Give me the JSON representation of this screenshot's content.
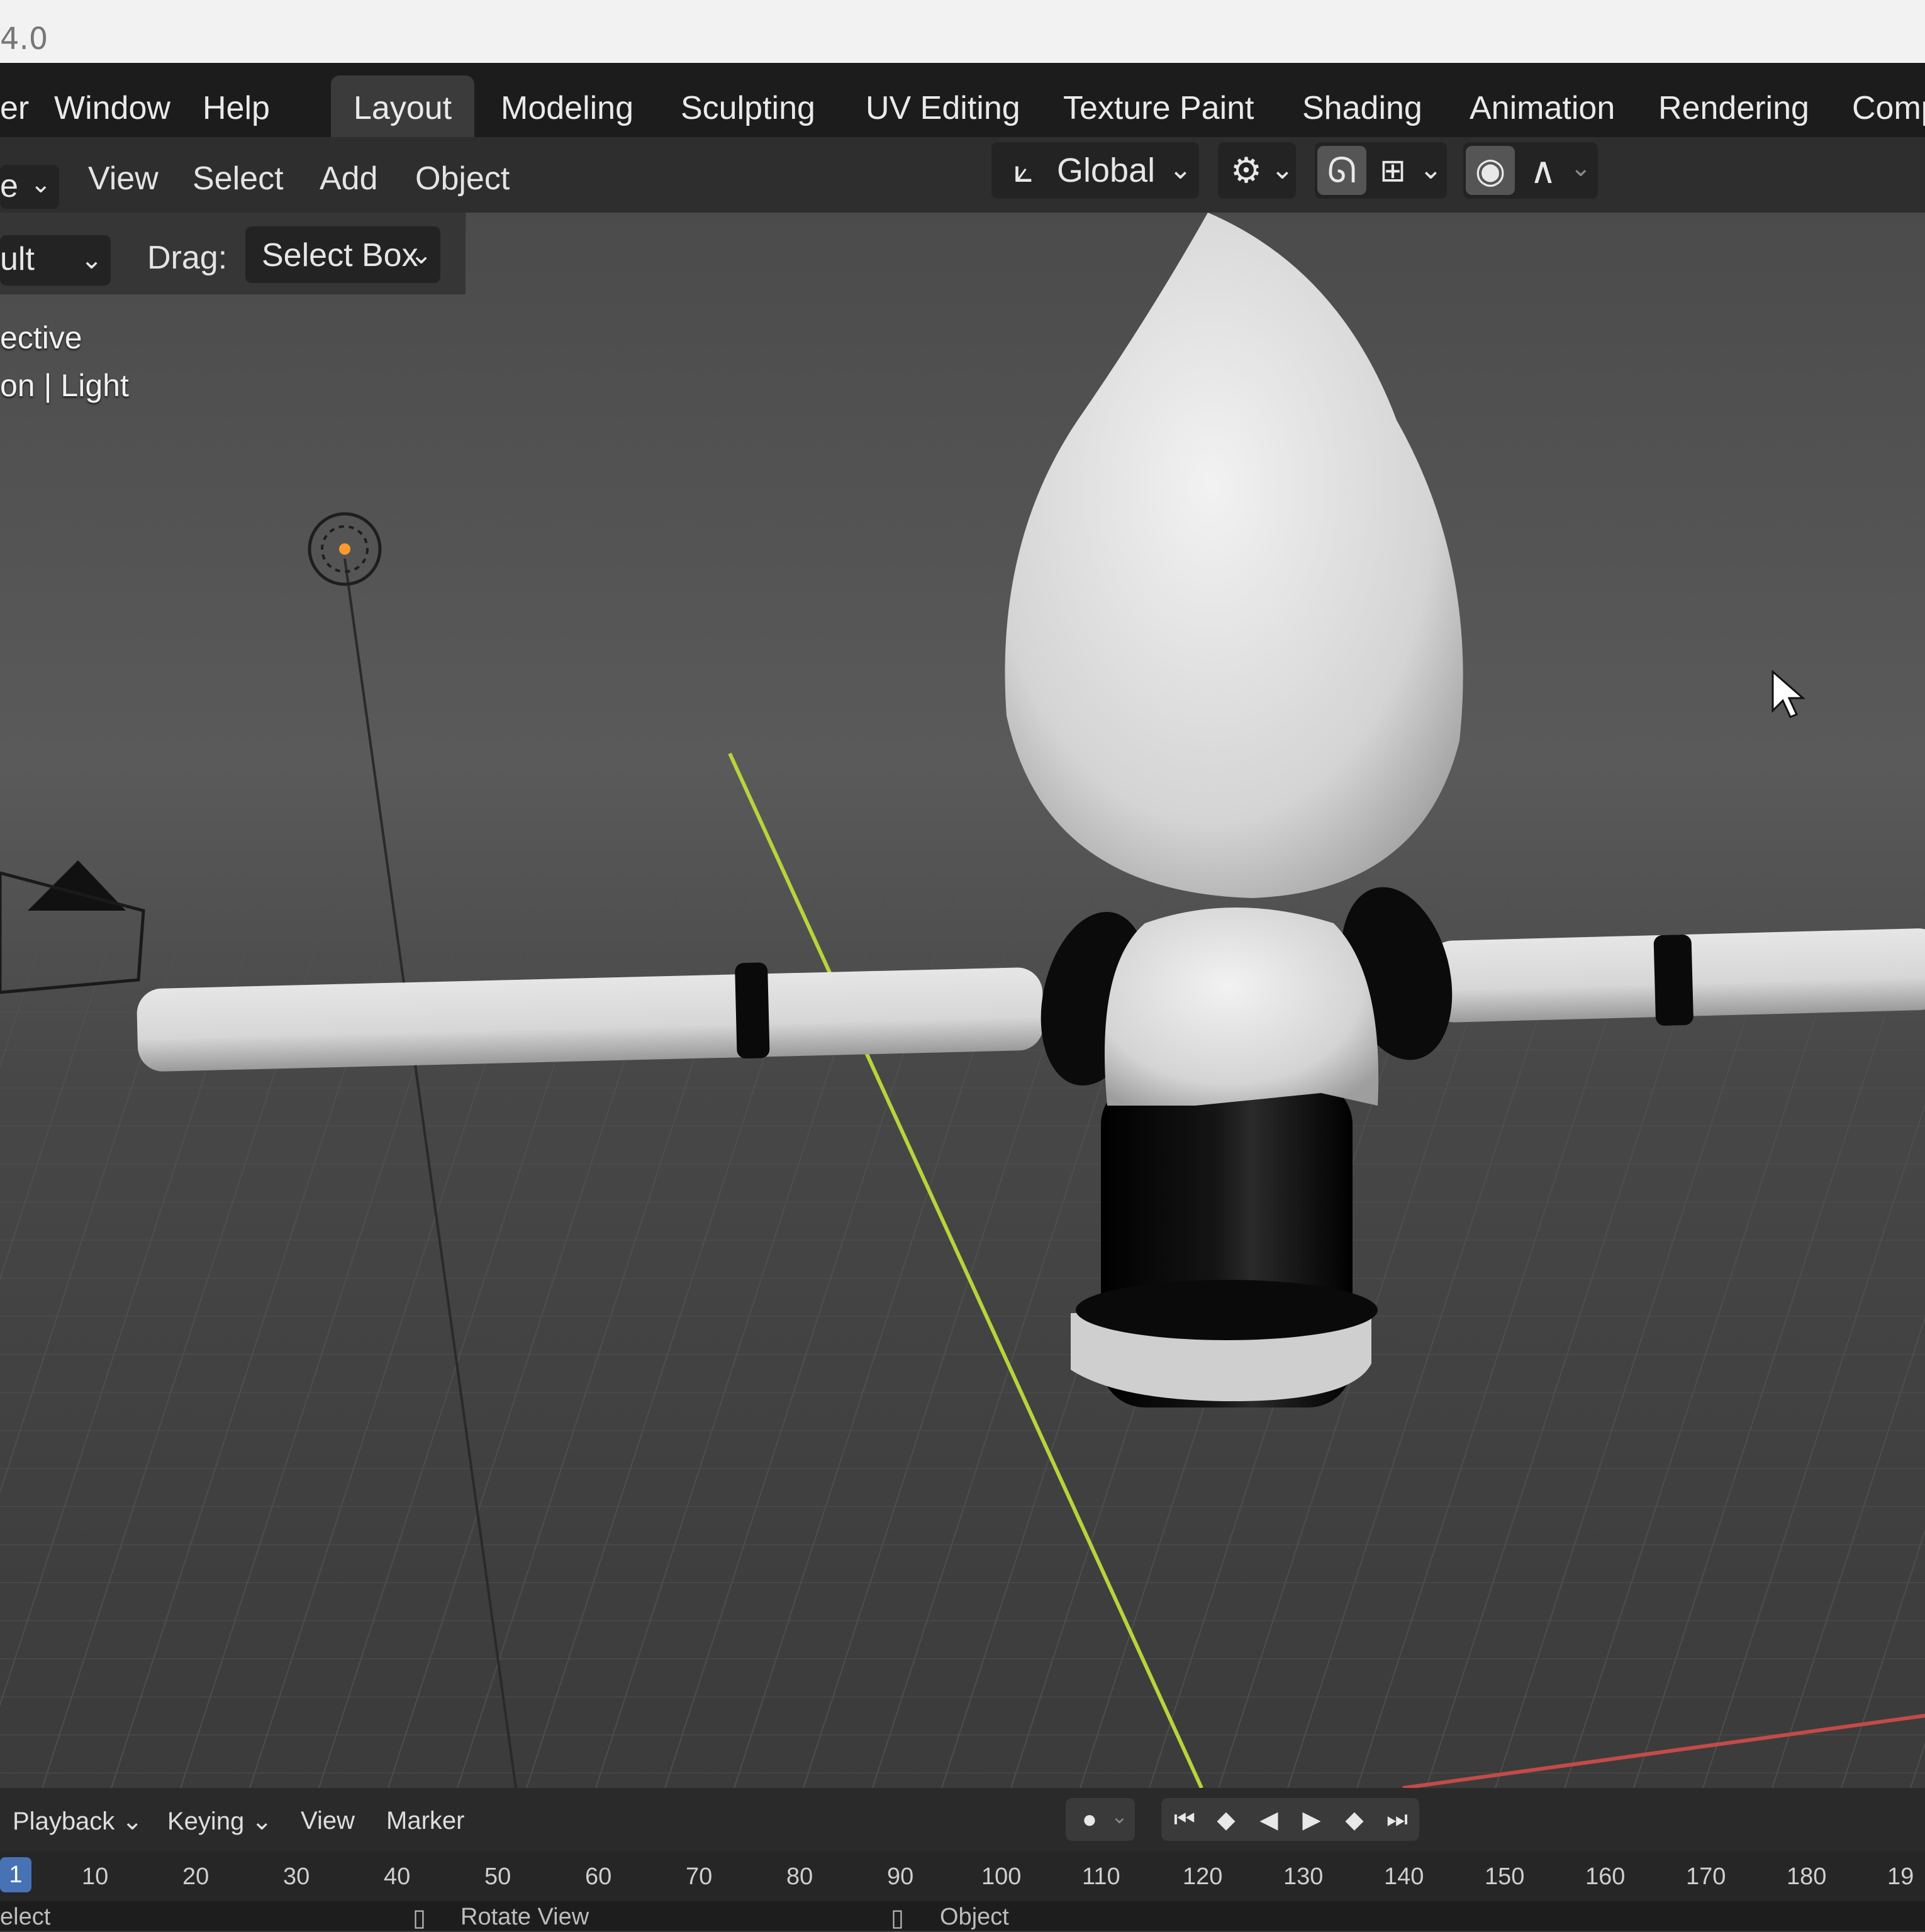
{
  "window": {
    "version": "4.0"
  },
  "menubar": {
    "items": [
      "er",
      "Window",
      "Help"
    ],
    "workspaces": [
      "Layout",
      "Modeling",
      "Sculpting",
      "UV Editing",
      "Texture Paint",
      "Shading",
      "Animation",
      "Rendering",
      "Comp"
    ],
    "active_workspace": "Layout"
  },
  "viewport_header": {
    "mode_dropdown": "e",
    "menus": [
      "View",
      "Select",
      "Add",
      "Object"
    ],
    "transform_orientation": "Global"
  },
  "tool_settings": {
    "orientation": "ult",
    "drag_label": "Drag:",
    "drag_value": "Select Box"
  },
  "overlay": {
    "line1": "ective",
    "line2_a": "on",
    "line2_b": "Light"
  },
  "timeline": {
    "menus": [
      "Playback",
      "Keying",
      "View",
      "Marker"
    ],
    "current_frame": "1",
    "ticks": [
      "10",
      "20",
      "30",
      "40",
      "50",
      "60",
      "70",
      "80",
      "90",
      "100",
      "110",
      "120",
      "130",
      "140",
      "150",
      "160",
      "170",
      "180",
      "19"
    ]
  },
  "statusbar": {
    "items": [
      "elect",
      "Rotate View",
      "Object"
    ]
  },
  "colors": {
    "accent_blue": "#4772b3",
    "y_axis": "#b7d43a",
    "x_axis": "#c44a4a",
    "light_orange": "#ff9a2e"
  }
}
